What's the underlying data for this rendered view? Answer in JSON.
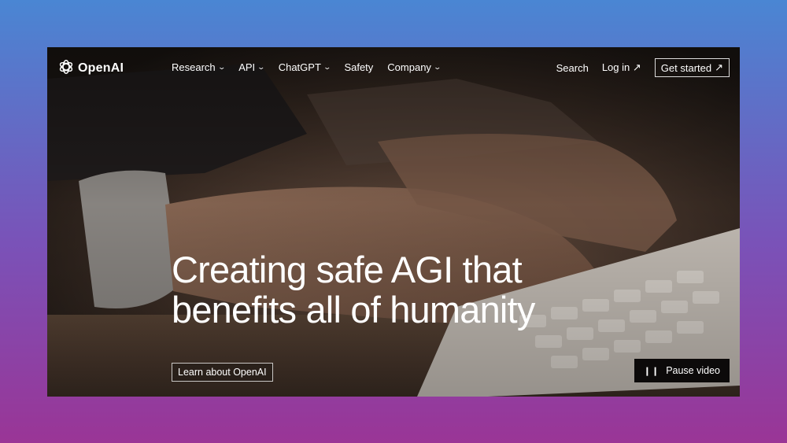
{
  "brand": {
    "name": "OpenAI",
    "logo_icon": "openai-knot-icon"
  },
  "nav": {
    "items": [
      {
        "label": "Research",
        "icon": "chevron-down-icon"
      },
      {
        "label": "API",
        "icon": "chevron-down-icon"
      },
      {
        "label": "ChatGPT",
        "icon": "chevron-down-icon"
      },
      {
        "label": "Safety"
      },
      {
        "label": "Company",
        "icon": "chevron-down-icon"
      }
    ],
    "search_label": "Search",
    "login_label": "Log in",
    "get_started_label": "Get started",
    "external_icon": "arrow-up-right-icon"
  },
  "hero": {
    "headline_line1": "Creating safe AGI that",
    "headline_line2": "benefits all of humanity",
    "cta_label": "Learn about OpenAI"
  },
  "video": {
    "pause_label": "Pause video",
    "pause_icon": "pause-icon"
  },
  "colors": {
    "background_top": "#4a86d3",
    "background_bottom": "#9a3596",
    "text": "#ffffff",
    "pause_button": "#0c0a0a"
  }
}
